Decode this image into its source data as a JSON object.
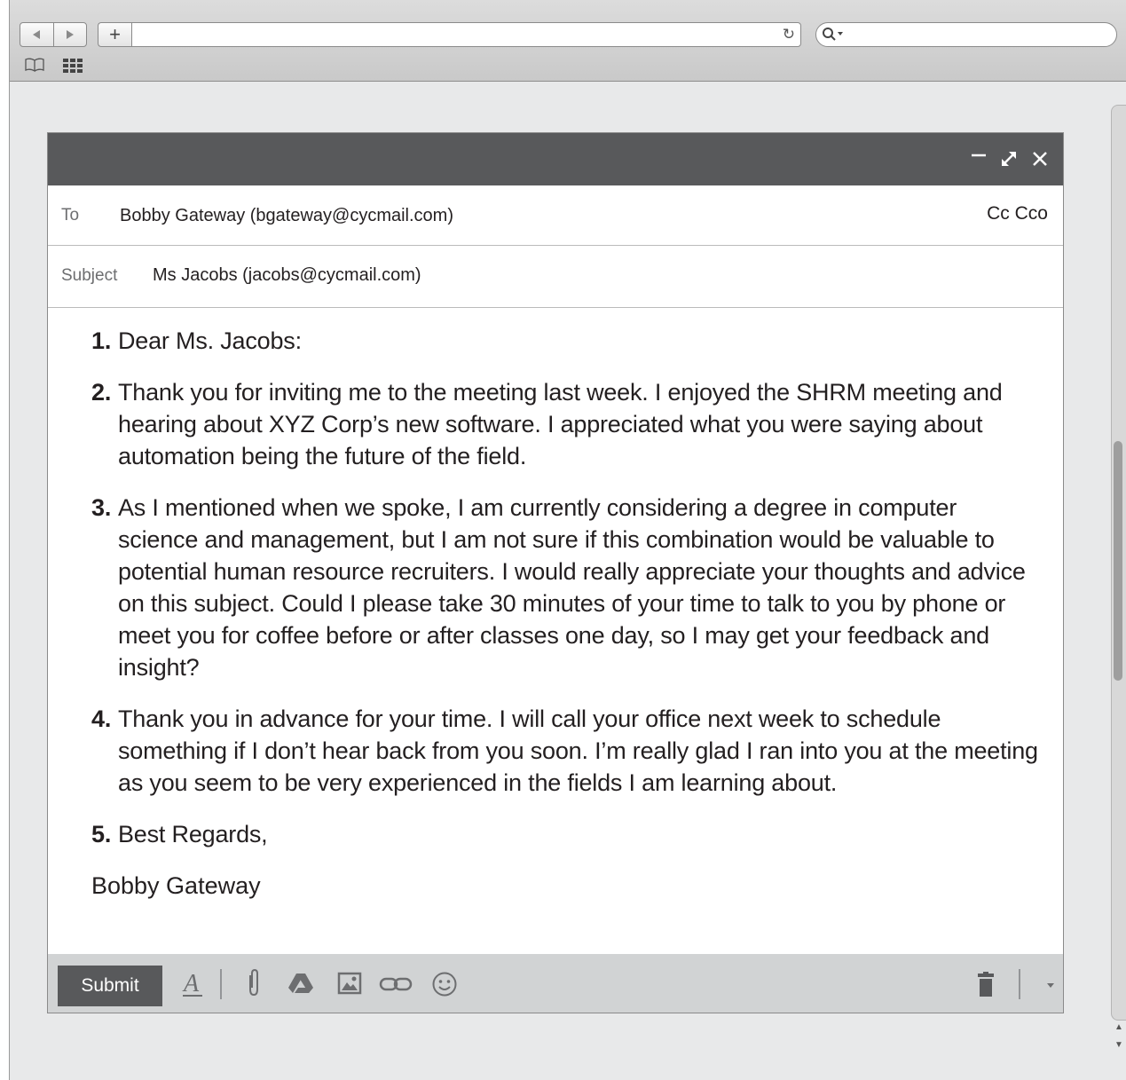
{
  "browser": {
    "back_icon": "back-arrow-icon",
    "forward_icon": "forward-arrow-icon",
    "new_tab_label": "+",
    "url": "",
    "search_placeholder": ""
  },
  "compose": {
    "header_controls": [
      "minimize-icon",
      "expand-icon",
      "close-icon"
    ],
    "to_label": "To",
    "to_value": "Bobby Gateway (bgateway@cycmail.com)",
    "cc_bcc_label": "Cc Cco",
    "subject_label": "Subject",
    "subject_value": "Ms Jacobs (jacobs@cycmail.com)",
    "paragraphs": [
      {
        "num": "1.",
        "text": "Dear Ms. Jacobs:"
      },
      {
        "num": "2.",
        "text": "Thank you for inviting me to the meeting last week. I enjoyed the SHRM meeting and hearing about XYZ Corp’s new software. I appreciated what you were saying about automation being the future of the field."
      },
      {
        "num": "3.",
        "text": "As I mentioned when we spoke, I am currently considering a degree in computer science and management, but I am not sure if this combination would be valuable to potential human resource recruiters. I would really appreciate your thoughts and advice on this subject. Could I please take 30 minutes of your time to talk to you by phone or meet you for coffee before or after classes one day, so I may get your feedback and insight?"
      },
      {
        "num": "4.",
        "text": "Thank you in advance for your time. I will call your office next week to schedule something if I don’t hear back from you soon. I’m really glad I ran into you at the meeting as you seem to be very experienced in the fields I am learning about."
      },
      {
        "num": "5.",
        "text": "Best Regards,"
      }
    ],
    "signature": "Bobby Gateway",
    "submit_label": "Submit",
    "format_icon_text": "A"
  },
  "colors": {
    "header_bg": "#58595b",
    "footer_bg": "#d1d3d4",
    "text": "#231f20",
    "label": "#6d6e70"
  }
}
